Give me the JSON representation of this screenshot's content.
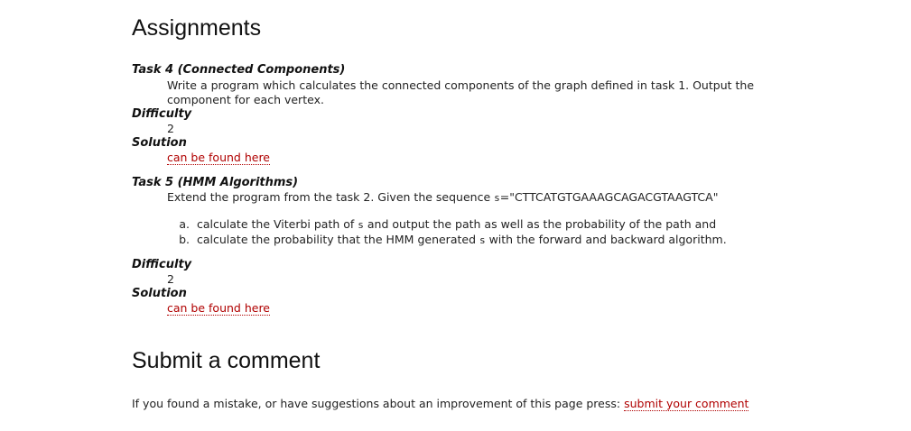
{
  "assignments_title": "Assignments",
  "task4": {
    "title": "Task 4 (Connected Components)",
    "description": "Write a program which calculates the connected components of the graph defined in task 1. Output the component for each vertex.",
    "difficulty_label": "Difficulty",
    "difficulty_value": "2",
    "solution_label": "Solution",
    "solution_link": "can be found here"
  },
  "task5": {
    "title": "Task 5 (HMM Algorithms)",
    "description_before": "Extend the program from the task 2. Given the sequence ",
    "var": "s",
    "sequence_value": "=\"CTTCATGTGAAAGCAGACGTAAGTCA\"",
    "items": [
      {
        "marker": "a.",
        "before": "calculate the Viterbi path of ",
        "after": " and output the path as well as the probability of the path and"
      },
      {
        "marker": "b.",
        "before": "calculate the probability that the HMM generated ",
        "after": " with the forward and backward algorithm."
      }
    ],
    "difficulty_label": "Difficulty",
    "difficulty_value": "2",
    "solution_label": "Solution",
    "solution_link": "can be found here"
  },
  "comment": {
    "title": "Submit a comment",
    "text": "If you found a mistake, or have suggestions about an improvement of this page press: ",
    "link": "submit your comment"
  }
}
